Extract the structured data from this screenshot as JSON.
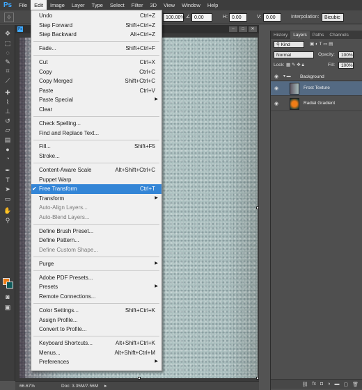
{
  "menubar": {
    "logo": "Ps",
    "items": [
      "File",
      "Edit",
      "Image",
      "Layer",
      "Type",
      "Select",
      "Filter",
      "3D",
      "View",
      "Window",
      "Help"
    ],
    "active": "Edit"
  },
  "options_bar": {
    "width_pct": "100.00%",
    "angle": "0.00",
    "h_label": "H:",
    "h_value": "0.00",
    "v_label": "V:",
    "v_value": "0.00",
    "interpolation_label": "Interpolation:",
    "interpolation_value": "Bicubic"
  },
  "document": {
    "tab_icon": "Ps",
    "zoom": "66.67%",
    "doc_size": "Doc: 3.35M/7.56M"
  },
  "tool_icons": [
    "move-icon",
    "marquee-icon",
    "lasso-icon",
    "quick-select-icon",
    "crop-icon",
    "eyedropper-icon",
    "healing-icon",
    "brush-icon",
    "clone-stamp-icon",
    "history-brush-icon",
    "eraser-icon",
    "gradient-icon",
    "blur-icon",
    "dodge-icon",
    "pen-icon",
    "type-icon",
    "path-select-icon",
    "shape-icon",
    "hand-icon",
    "zoom-icon"
  ],
  "colors": {
    "foreground": "#ee7d16",
    "background": "#0e5a5a",
    "highlight": "#3385d6",
    "selected_layer": "#546a83"
  },
  "edit_menu": {
    "items": [
      {
        "label": "Undo",
        "shortcut": "Ctrl+Z"
      },
      {
        "label": "Step Forward",
        "shortcut": "Shift+Ctrl+Z"
      },
      {
        "label": "Step Backward",
        "shortcut": "Alt+Ctrl+Z"
      },
      {
        "sep": true
      },
      {
        "label": "Fade...",
        "shortcut": "Shift+Ctrl+F"
      },
      {
        "sep": true
      },
      {
        "label": "Cut",
        "shortcut": "Ctrl+X"
      },
      {
        "label": "Copy",
        "shortcut": "Ctrl+C"
      },
      {
        "label": "Copy Merged",
        "shortcut": "Shift+Ctrl+C"
      },
      {
        "label": "Paste",
        "shortcut": "Ctrl+V"
      },
      {
        "label": "Paste Special",
        "submenu": true
      },
      {
        "label": "Clear"
      },
      {
        "sep": true
      },
      {
        "label": "Check Spelling..."
      },
      {
        "label": "Find and Replace Text..."
      },
      {
        "sep": true
      },
      {
        "label": "Fill...",
        "shortcut": "Shift+F5"
      },
      {
        "label": "Stroke..."
      },
      {
        "sep": true
      },
      {
        "label": "Content-Aware Scale",
        "shortcut": "Alt+Shift+Ctrl+C"
      },
      {
        "label": "Puppet Warp"
      },
      {
        "label": "Free Transform",
        "shortcut": "Ctrl+T",
        "highlighted": true,
        "checked": true
      },
      {
        "label": "Transform",
        "submenu": true
      },
      {
        "label": "Auto-Align Layers...",
        "disabled": true
      },
      {
        "label": "Auto-Blend Layers...",
        "disabled": true
      },
      {
        "sep": true
      },
      {
        "label": "Define Brush Preset..."
      },
      {
        "label": "Define Pattern..."
      },
      {
        "label": "Define Custom Shape...",
        "disabled": true
      },
      {
        "sep": true
      },
      {
        "label": "Purge",
        "submenu": true
      },
      {
        "sep": true
      },
      {
        "label": "Adobe PDF Presets..."
      },
      {
        "label": "Presets",
        "submenu": true
      },
      {
        "label": "Remote Connections..."
      },
      {
        "sep": true
      },
      {
        "label": "Color Settings...",
        "shortcut": "Shift+Ctrl+K"
      },
      {
        "label": "Assign Profile..."
      },
      {
        "label": "Convert to Profile..."
      },
      {
        "sep": true
      },
      {
        "label": "Keyboard Shortcuts...",
        "shortcut": "Alt+Shift+Ctrl+K"
      },
      {
        "label": "Menus...",
        "shortcut": "Alt+Shift+Ctrl+M"
      },
      {
        "label": "Preferences",
        "submenu": true
      }
    ]
  },
  "panels": {
    "tabs": [
      "History",
      "Layers",
      "Paths",
      "Channels"
    ],
    "active_tab": "Layers",
    "filter_kind": "Kind",
    "blend_mode": "Normal",
    "opacity_label": "Opacity:",
    "opacity_value": "100%",
    "lock_label": "Lock:",
    "fill_label": "Fill:",
    "fill_value": "100%",
    "layers": [
      {
        "name": "Background",
        "group": true
      },
      {
        "name": "Frost Texture",
        "selected": true
      },
      {
        "name": "Radial Gradient"
      }
    ],
    "bottom_icons": [
      "link-icon",
      "fx-icon",
      "mask-icon",
      "adjustment-icon",
      "folder-icon",
      "new-layer-icon",
      "trash-icon"
    ]
  }
}
